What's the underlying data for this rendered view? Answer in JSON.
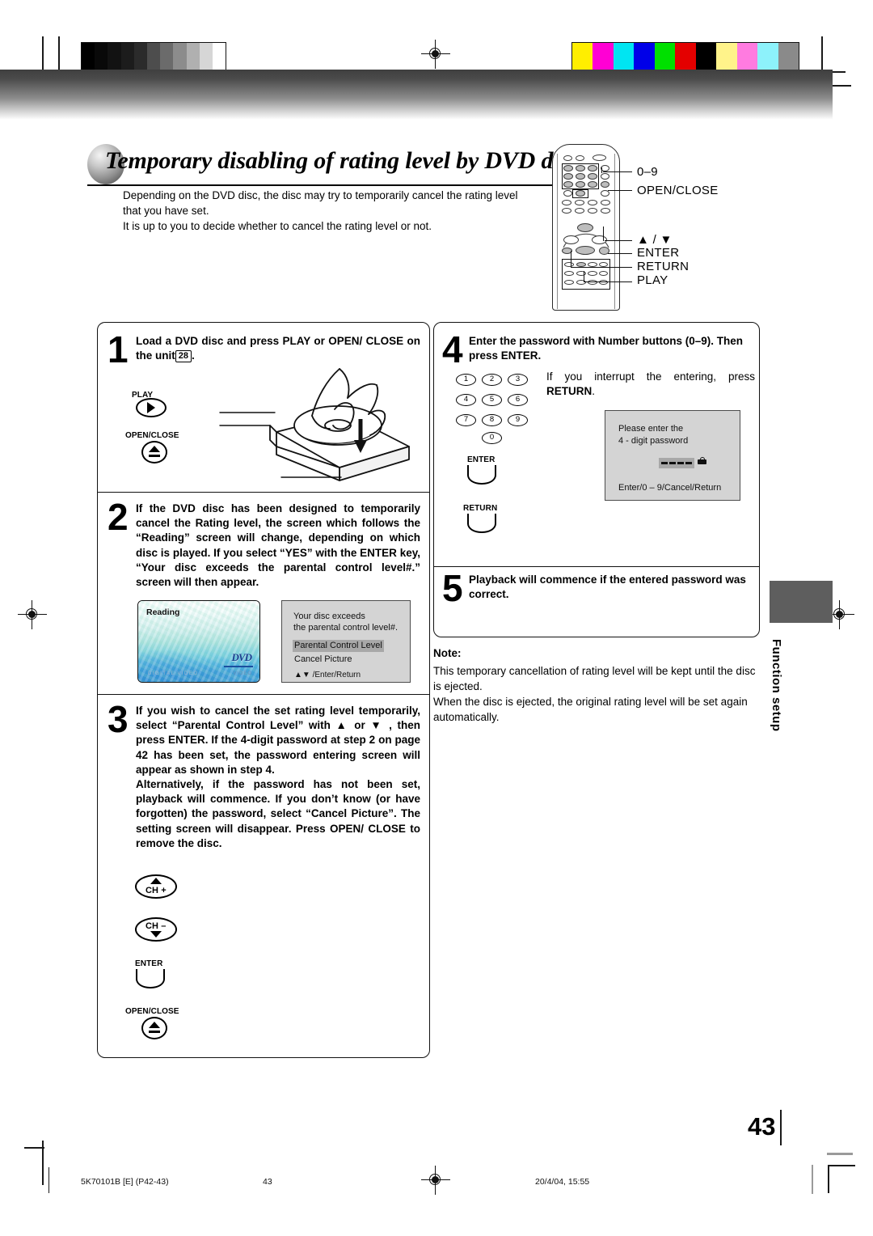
{
  "page": {
    "heading": "Temporary disabling of rating level by DVD disc",
    "intro": "Depending on the DVD disc, the disc may try to temporarily cancel the rating level that you have set.\nIt is up to you to decide whether to cancel the rating level or not.",
    "page_number": "43",
    "side_tab": "Function setup"
  },
  "remote_labels": {
    "numbers": "0–9",
    "open_close": "OPEN/CLOSE",
    "updown": "▲ / ▼",
    "enter": "ENTER",
    "return": "RETURN",
    "play": "PLAY"
  },
  "steps": [
    {
      "number": "1",
      "text_before": "Load a DVD disc and press PLAY or OPEN/ CLOSE on the unit",
      "badge": "28",
      "text_after": "."
    },
    {
      "number": "2",
      "text": "If the DVD disc has been designed to temporarily cancel the Rating level, the screen which follows the “Reading” screen will change, depending on which disc is played. If you select “YES” with the ENTER key, “Your disc exceeds the parental control level#.” screen will then appear."
    },
    {
      "number": "3",
      "text": "If you wish to cancel the set rating level temporarily, select “Parental Control Level” with ▲ or ▼ , then press ENTER. If the 4-digit password at step 2 on page 42 has been set, the password entering screen will appear as shown in step 4.\nAlternatively, if the password has not been set, playback will commence. If you don’t know (or have forgotten) the password, select “Cancel Picture”. The setting screen will disappear. Press OPEN/ CLOSE to remove the disc."
    },
    {
      "number": "4",
      "text": "Enter the password with Number buttons (0–9). Then press ENTER.",
      "body": "If you interrupt the entering, press",
      "body_bold": "RETURN",
      "body_end": "."
    },
    {
      "number": "5",
      "text": "Playback will commence if the entered password was correct."
    }
  ],
  "step1_buttons": {
    "play": "PLAY",
    "open_close": "OPEN/CLOSE"
  },
  "step3_buttons": {
    "ch_up": "CH +",
    "ch_down": "CH –",
    "enter": "ENTER",
    "open_close": "OPEN/CLOSE"
  },
  "step4_buttons": {
    "numbers": [
      "1",
      "2",
      "3",
      "4",
      "5",
      "6",
      "7",
      "8",
      "9",
      "0"
    ],
    "enter": "ENTER",
    "return": "RETURN"
  },
  "reading_screen": {
    "label": "Reading",
    "logo": "DVD",
    "logo_sub": "VIDEO",
    "logo_sub2": "DIGITAL VIDEO"
  },
  "parental_osd": {
    "line1": "Your disc exceeds",
    "line2": "the parental control level#.",
    "option_selected": "Parental Control Level",
    "option_other": "Cancel Picture",
    "hint": "▲▼ /Enter/Return"
  },
  "password_osd": {
    "line1": "Please enter the",
    "line2": "4 - digit password",
    "hint": "Enter/0 – 9/Cancel/Return"
  },
  "note": {
    "title": "Note:",
    "body": "This temporary cancellation of rating level will be kept until the disc is ejected.\nWhen the disc is ejected, the original rating level will be set again automatically."
  },
  "footer": {
    "doc_id": "5K70101B [E] (P42-43)",
    "page": "43",
    "timestamp": "20/4/04, 15:55"
  },
  "colors": {
    "gray_bar": [
      "#000000",
      "#0a0a0a",
      "#161616",
      "#1f1f1f",
      "#2e2e2e",
      "#4d4d4d",
      "#6b6b6b",
      "#8c8c8c",
      "#b0b0b0",
      "#d6d6d6",
      "#ffffff"
    ],
    "color_bar": [
      "#ffee00",
      "#ff00d4",
      "#00e5f2",
      "#0000e8",
      "#00e000",
      "#e40000",
      "#000000",
      "#fff38a",
      "#ff7be0",
      "#8df2fb",
      "#8a8a8a"
    ],
    "tab_block": "#5e5e5e",
    "osd_bg": "#d4d4d4",
    "osd_highlight": "#a8a8a8"
  }
}
